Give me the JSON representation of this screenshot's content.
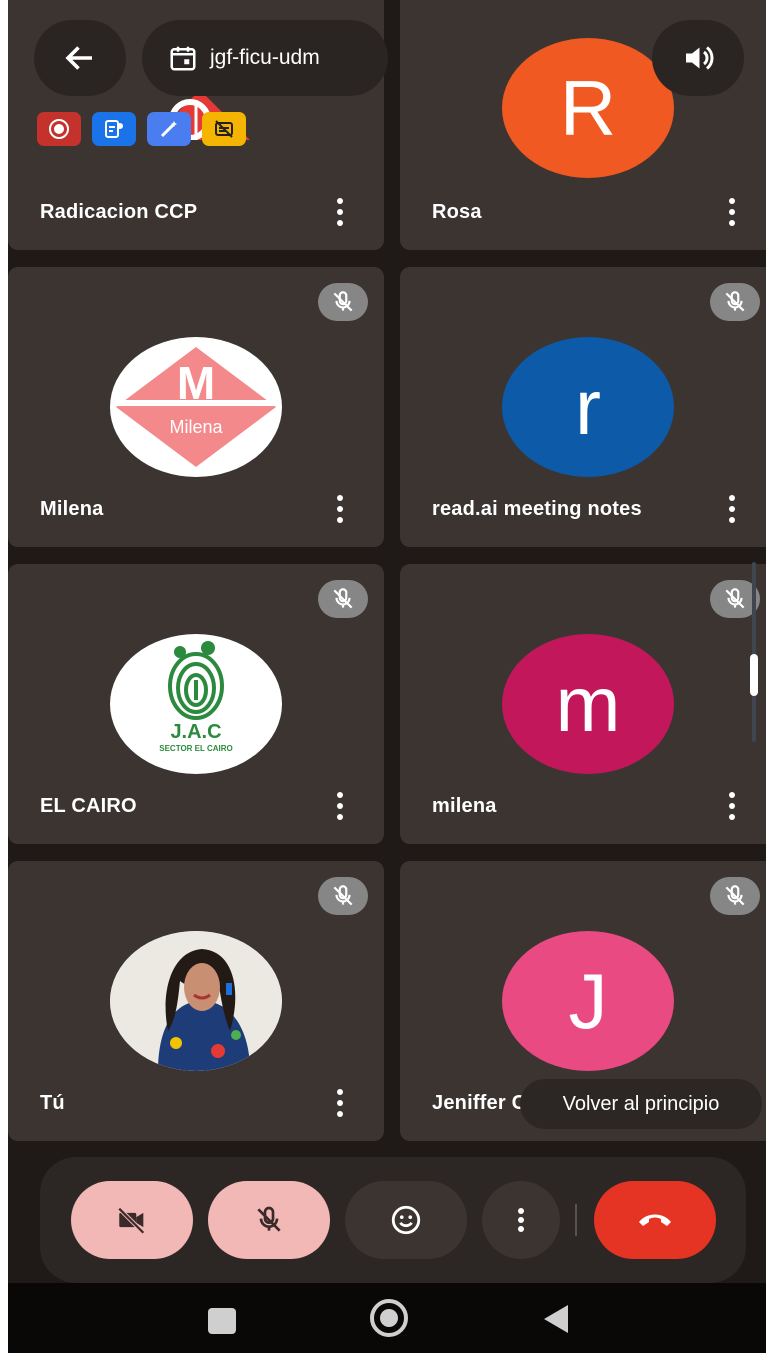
{
  "meeting": {
    "code": "jgf-ficu-udm"
  },
  "participants": [
    {
      "name": "Radicacion CCP"
    },
    {
      "name": "Rosa",
      "initial": "R",
      "color": "#f05a22"
    },
    {
      "name": "Milena",
      "logo_letter": "M",
      "logo_text": "Milena",
      "color": "#f4898b"
    },
    {
      "name": "read.ai meeting notes",
      "initial": "r",
      "color": "#0d5aa8"
    },
    {
      "name": "EL CAIRO",
      "logo_title": "J.A.C",
      "logo_subtitle": "SECTOR EL CAIRO",
      "color": "#2b8a3e"
    },
    {
      "name": "milena",
      "initial": "m",
      "color": "#c2185b"
    },
    {
      "name": "Tú"
    },
    {
      "name": "Jeniffer Ca",
      "initial": "J",
      "color": "#e94a82"
    }
  ],
  "toast": {
    "text": "Volver al principio"
  },
  "colors": {
    "background": "#1f1a17",
    "tile": "#3b3431",
    "end_call": "#e53423",
    "muted_control": "#f2b8b5",
    "control": "#3b3431"
  },
  "icons": [
    "back-arrow-icon",
    "calendar-icon",
    "speaker-icon",
    "record-icon",
    "transcript-icon",
    "notes-icon",
    "captions-off-icon",
    "mic-off-icon",
    "more-vert-icon",
    "camera-off-icon",
    "emoji-icon",
    "end-call-icon",
    "nav-recents-icon",
    "nav-home-icon",
    "nav-back-icon"
  ]
}
